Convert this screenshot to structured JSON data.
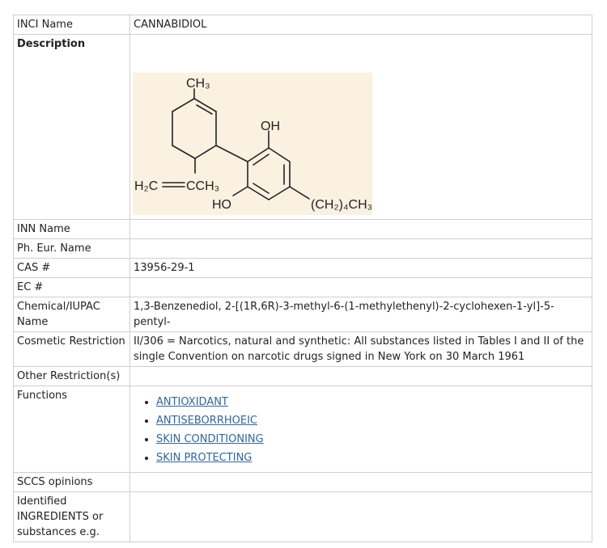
{
  "rows": {
    "inci": {
      "label": "INCI Name",
      "value": "CANNABIDIOL"
    },
    "description": {
      "label": "Description"
    },
    "inn": {
      "label": "INN Name",
      "value": ""
    },
    "pheur": {
      "label": "Ph. Eur. Name",
      "value": ""
    },
    "cas": {
      "label": "CAS #",
      "value": "13956-29-1"
    },
    "ec": {
      "label": "EC #",
      "value": ""
    },
    "iupac": {
      "label": "Chemical/IUPAC Name",
      "value": "1,3-Benzenediol, 2-[(1R,6R)-3-methyl-6-(1-methylethenyl)-2-cyclohexen-1-yl]-5-pentyl-"
    },
    "cosmetic": {
      "label": "Cosmetic Restriction",
      "value": "II/306 = Narcotics, natural and synthetic: All substances listed in Tables I and II of the single Convention on narcotic drugs signed in New York on 30 March 1961"
    },
    "other": {
      "label": "Other Restriction(s)",
      "value": ""
    },
    "functions": {
      "label": "Functions",
      "items": [
        "ANTIOXIDANT",
        "ANTISEBORRHOEIC",
        "SKIN CONDITIONING",
        "SKIN PROTECTING"
      ]
    },
    "sccs": {
      "label": "SCCS opinions",
      "value": ""
    },
    "identified": {
      "label": "Identified INGREDIENTS or substances e.g.",
      "value": ""
    }
  },
  "structure": {
    "ch3": "CH₃",
    "oh": "OH",
    "h2c": "H₂C",
    "cch3": "CCH₃",
    "ho": "HO",
    "chain": "(CH₂)₄CH₃"
  }
}
